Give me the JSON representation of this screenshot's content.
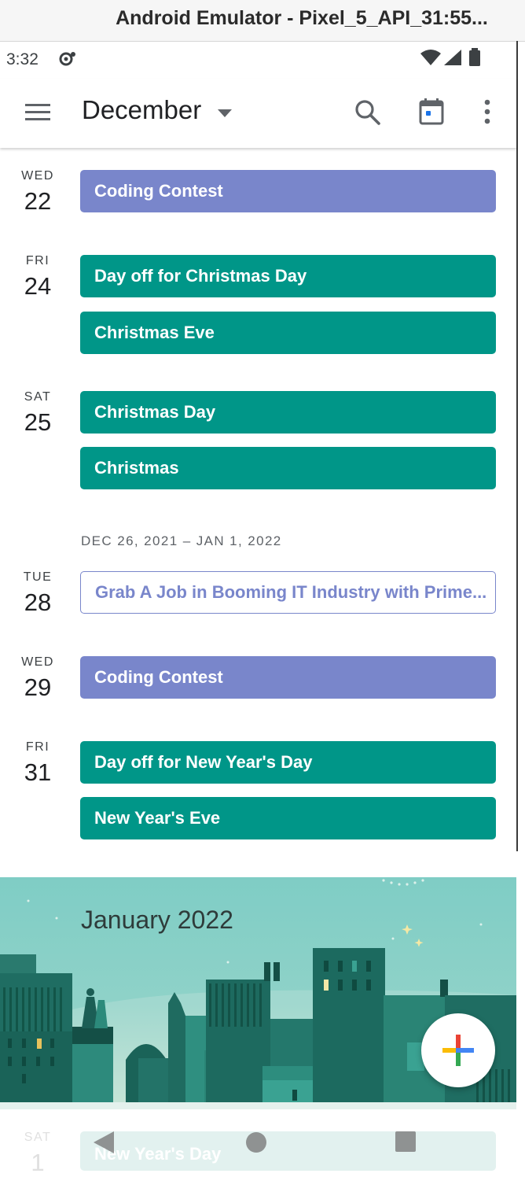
{
  "window": {
    "title": "Android Emulator - Pixel_5_API_31:55..."
  },
  "status_bar": {
    "time": "3:32"
  },
  "app_bar": {
    "month": "December"
  },
  "agenda": {
    "days": [
      {
        "abbr": "WED",
        "num": "22",
        "events": [
          "Coding Contest"
        ]
      },
      {
        "abbr": "FRI",
        "num": "24",
        "events": [
          "Day off for Christmas Day",
          "Christmas Eve"
        ]
      },
      {
        "abbr": "SAT",
        "num": "25",
        "events": [
          "Christmas Day",
          "Christmas"
        ]
      }
    ],
    "week_range": "DEC 26, 2021 – JAN 1, 2022",
    "days2": [
      {
        "abbr": "TUE",
        "num": "28",
        "events": [
          "Grab A Job in Booming IT Industry with Prime..."
        ]
      },
      {
        "abbr": "WED",
        "num": "29",
        "events": [
          "Coding Contest"
        ]
      },
      {
        "abbr": "FRI",
        "num": "31",
        "events": [
          "Day off for New Year's Day",
          "New Year's Eve"
        ]
      }
    ]
  },
  "month_banner": {
    "title": "January 2022"
  },
  "peek": {
    "abbr": "SAT",
    "num": "1",
    "event": "New Year's Day"
  },
  "colors": {
    "purple_event": "#7986cb",
    "teal_event": "#009688",
    "banner_teal": "#7fcdc5"
  },
  "icons": {
    "menu": "hamburger-menu-icon",
    "dropdown": "dropdown-arrow-icon",
    "search": "search-icon",
    "today": "calendar-today-icon",
    "more": "more-vert-icon",
    "fab": "google-plus-icon"
  }
}
